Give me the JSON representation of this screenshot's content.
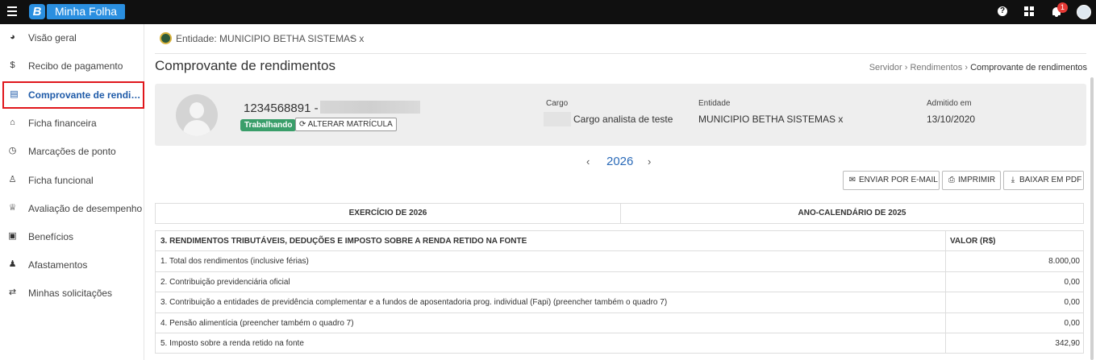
{
  "app": {
    "logo_letter": "B",
    "name": "Minha Folha",
    "help_icon": "question-icon",
    "notifications_count": "1"
  },
  "sidebar": {
    "items": [
      {
        "label": "Visão geral",
        "icon": "pie-chart-icon",
        "glyph": "◕"
      },
      {
        "label": "Recibo de pagamento",
        "icon": "dollar-icon",
        "glyph": "$"
      },
      {
        "label": "Comprovante de rendimentos",
        "icon": "document-icon",
        "glyph": "▤"
      },
      {
        "label": "Ficha financeira",
        "icon": "bank-icon",
        "glyph": "⌂"
      },
      {
        "label": "Marcações de ponto",
        "icon": "clock-icon",
        "glyph": "◷"
      },
      {
        "label": "Ficha funcional",
        "icon": "user-icon",
        "glyph": "♙"
      },
      {
        "label": "Avaliação de desempenho",
        "icon": "trophy-icon",
        "glyph": "♕"
      },
      {
        "label": "Benefícios",
        "icon": "gift-icon",
        "glyph": "▣"
      },
      {
        "label": "Afastamentos",
        "icon": "user-times-icon",
        "glyph": "♟"
      },
      {
        "label": "Minhas solicitações",
        "icon": "exchange-icon",
        "glyph": "⇄"
      }
    ]
  },
  "entity": {
    "label": "Entidade: MUNICIPIO BETHA SISTEMAS x",
    "caret": "⌄"
  },
  "page": {
    "title": "Comprovante de rendimentos",
    "breadcrumb": {
      "item1": "Servidor",
      "item2": "Rendimentos",
      "current": "Comprovante de rendimentos",
      "sep": "›"
    }
  },
  "employee": {
    "matricula": "1234568891 -",
    "status": "Trabalhando",
    "alter_label": "ALTERAR MATRÍCULA",
    "cargo_label": "Cargo",
    "cargo_value": "Cargo analista de teste",
    "entidade_label": "Entidade",
    "entidade_value": "MUNICIPIO BETHA SISTEMAS x",
    "admitido_label": "Admitido em",
    "admitido_value": "13/10/2020"
  },
  "year_nav": {
    "prev": "‹",
    "year": "2026",
    "next": "›"
  },
  "actions": {
    "email": "ENVIAR POR E-MAIL",
    "print": "IMPRIMIR",
    "pdf": "BAIXAR EM PDF"
  },
  "exercise": {
    "exercicio": "EXERCÍCIO DE 2026",
    "ano_calendario": "ANO-CALENDÁRIO DE 2025"
  },
  "income_table": {
    "header": {
      "desc": "3. RENDIMENTOS TRIBUTÁVEIS, DEDUÇÕES E IMPOSTO SOBRE A RENDA RETIDO NA FONTE",
      "value": "VALOR (R$)"
    },
    "rows": [
      {
        "desc": "1. Total dos rendimentos (inclusive férias)",
        "value": "8.000,00"
      },
      {
        "desc": "2. Contribuição previdenciária oficial",
        "value": "0,00"
      },
      {
        "desc": "3. Contribuição a entidades de previdência complementar e a fundos de aposentadoria prog. individual (Fapi) (preencher também o quadro 7)",
        "value": "0,00"
      },
      {
        "desc": "4. Pensão alimentícia (preencher também o quadro 7)",
        "value": "0,00"
      },
      {
        "desc": "5. Imposto sobre a renda retido na fonte",
        "value": "342,90"
      }
    ]
  }
}
